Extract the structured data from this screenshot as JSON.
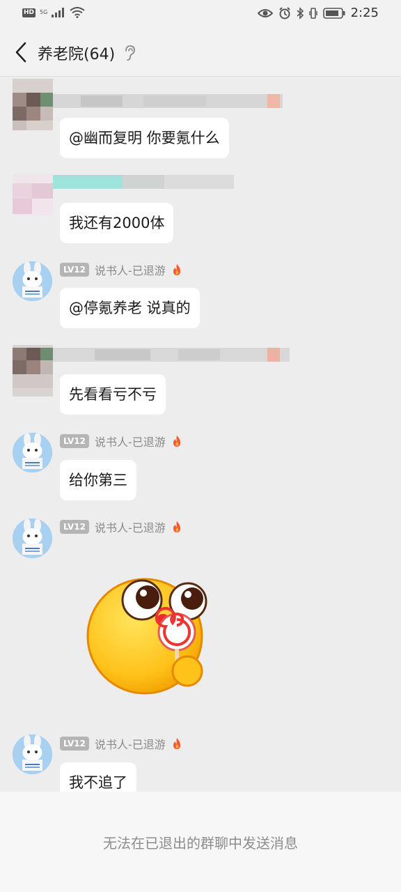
{
  "status_bar": {
    "left_badges": [
      "HD",
      "5G"
    ],
    "time": "2:25",
    "icons": [
      "signal-icon",
      "wifi-icon",
      "eye-icon",
      "alarm-icon",
      "bluetooth-icon",
      "vibrate-icon",
      "battery-icon"
    ]
  },
  "header": {
    "title": "养老院(64)",
    "back_icon": "chevron-left-icon",
    "right_icon": "ear-icon"
  },
  "messages": [
    {
      "sender": "",
      "text": "@幽而复明 你要氪什么"
    },
    {
      "sender": "",
      "text": "我还有2000体"
    },
    {
      "level": "LV12",
      "sender": "说书人-已退游",
      "text": "@停氪养老 说真的"
    },
    {
      "sender": "",
      "text": "先看看亏不亏"
    },
    {
      "level": "LV12",
      "sender": "说书人-已退游",
      "text": "给你第三"
    },
    {
      "level": "LV12",
      "sender": "说书人-已退游",
      "sticker": "lollipop-emoji"
    },
    {
      "level": "LV12",
      "sender": "说书人-已退游",
      "text": "我不追了"
    }
  ],
  "bottom_notice": "无法在已退出的群聊中发送消息",
  "colors": {
    "background": "#ededed",
    "bubble": "#ffffff",
    "level_badge": "#b5b5b5",
    "fire": "#f25c2c"
  }
}
